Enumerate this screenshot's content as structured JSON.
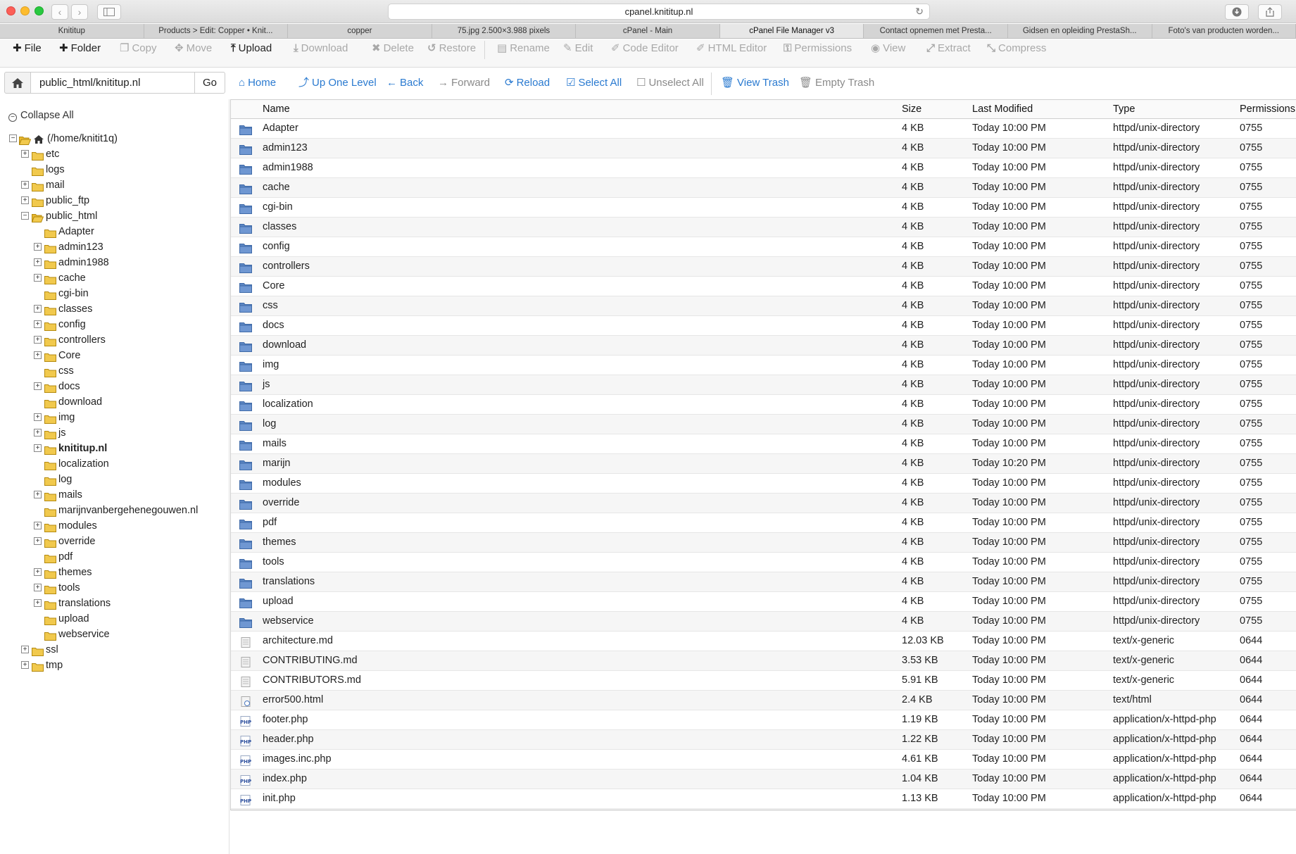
{
  "browser": {
    "url": "cpanel.knititup.nl",
    "tabs": [
      {
        "label": "Knititup",
        "active": false
      },
      {
        "label": "Products > Edit: Copper • Knit...",
        "active": false
      },
      {
        "label": "copper",
        "active": false
      },
      {
        "label": "75.jpg 2.500×3.988 pixels",
        "active": false
      },
      {
        "label": "cPanel - Main",
        "active": false
      },
      {
        "label": "cPanel File Manager v3",
        "active": true
      },
      {
        "label": "Contact opnemen met Presta...",
        "active": false
      },
      {
        "label": "Gidsen en opleiding PrestaSh...",
        "active": false
      },
      {
        "label": "Foto's van producten worden...",
        "active": false
      }
    ]
  },
  "toolbar": {
    "buttons": [
      {
        "label": "File",
        "icon": "plus-icon",
        "enabled": true
      },
      {
        "label": "Folder",
        "icon": "plus-icon",
        "enabled": true
      },
      {
        "label": "Copy",
        "icon": "copy-icon",
        "enabled": false
      },
      {
        "label": "Move",
        "icon": "move-icon",
        "enabled": false
      },
      {
        "label": "Upload",
        "icon": "upload-icon",
        "enabled": true
      },
      {
        "label": "Download",
        "icon": "download-icon",
        "enabled": false
      },
      {
        "label": "Delete",
        "icon": "delete-icon",
        "enabled": false
      },
      {
        "label": "Restore",
        "icon": "restore-icon",
        "enabled": false
      },
      {
        "label": "Rename",
        "icon": "rename-icon",
        "enabled": false
      },
      {
        "label": "Edit",
        "icon": "pencil-icon",
        "enabled": false
      },
      {
        "label": "Code Editor",
        "icon": "code-editor-icon",
        "enabled": false
      },
      {
        "label": "HTML Editor",
        "icon": "html-editor-icon",
        "enabled": false
      },
      {
        "label": "Permissions",
        "icon": "key-icon",
        "enabled": false
      },
      {
        "label": "View",
        "icon": "eye-icon",
        "enabled": false
      },
      {
        "label": "Extract",
        "icon": "extract-icon",
        "enabled": false
      },
      {
        "label": "Compress",
        "icon": "compress-icon",
        "enabled": false
      }
    ]
  },
  "pathbar": {
    "path": "public_html/knititup.nl",
    "go_label": "Go",
    "links": [
      {
        "label": "Home",
        "icon": "home-icon",
        "enabled": true
      },
      {
        "label": "Up One Level",
        "icon": "level-up-icon",
        "enabled": true
      },
      {
        "label": "Back",
        "icon": "arrow-left-icon",
        "enabled": true
      },
      {
        "label": "Forward",
        "icon": "arrow-right-icon",
        "enabled": false
      },
      {
        "label": "Reload",
        "icon": "reload-icon",
        "enabled": true
      },
      {
        "label": "Select All",
        "icon": "check-square-icon",
        "enabled": true
      },
      {
        "label": "Unselect All",
        "icon": "square-icon",
        "enabled": false
      },
      {
        "label": "View Trash",
        "icon": "trash-icon",
        "enabled": true
      },
      {
        "label": "Empty Trash",
        "icon": "trash-icon",
        "enabled": false
      }
    ]
  },
  "tree": {
    "collapse_label": "Collapse All",
    "root_label": "(/home/knitit1q)",
    "nodes": [
      {
        "label": "etc",
        "level": 1,
        "toggle": "plus"
      },
      {
        "label": "logs",
        "level": 1,
        "toggle": ""
      },
      {
        "label": "mail",
        "level": 1,
        "toggle": "plus"
      },
      {
        "label": "public_ftp",
        "level": 1,
        "toggle": "plus"
      },
      {
        "label": "public_html",
        "level": 1,
        "toggle": "minus",
        "open": true
      },
      {
        "label": "Adapter",
        "level": 2,
        "toggle": ""
      },
      {
        "label": "admin123",
        "level": 2,
        "toggle": "plus"
      },
      {
        "label": "admin1988",
        "level": 2,
        "toggle": "plus"
      },
      {
        "label": "cache",
        "level": 2,
        "toggle": "plus"
      },
      {
        "label": "cgi-bin",
        "level": 2,
        "toggle": ""
      },
      {
        "label": "classes",
        "level": 2,
        "toggle": "plus"
      },
      {
        "label": "config",
        "level": 2,
        "toggle": "plus"
      },
      {
        "label": "controllers",
        "level": 2,
        "toggle": "plus"
      },
      {
        "label": "Core",
        "level": 2,
        "toggle": "plus"
      },
      {
        "label": "css",
        "level": 2,
        "toggle": ""
      },
      {
        "label": "docs",
        "level": 2,
        "toggle": "plus"
      },
      {
        "label": "download",
        "level": 2,
        "toggle": ""
      },
      {
        "label": "img",
        "level": 2,
        "toggle": "plus"
      },
      {
        "label": "js",
        "level": 2,
        "toggle": "plus"
      },
      {
        "label": "knititup.nl",
        "level": 2,
        "toggle": "plus",
        "bold": true
      },
      {
        "label": "localization",
        "level": 2,
        "toggle": ""
      },
      {
        "label": "log",
        "level": 2,
        "toggle": ""
      },
      {
        "label": "mails",
        "level": 2,
        "toggle": "plus"
      },
      {
        "label": "marijnvanbergehenegouwen.nl",
        "level": 2,
        "toggle": ""
      },
      {
        "label": "modules",
        "level": 2,
        "toggle": "plus"
      },
      {
        "label": "override",
        "level": 2,
        "toggle": "plus"
      },
      {
        "label": "pdf",
        "level": 2,
        "toggle": ""
      },
      {
        "label": "themes",
        "level": 2,
        "toggle": "plus"
      },
      {
        "label": "tools",
        "level": 2,
        "toggle": "plus"
      },
      {
        "label": "translations",
        "level": 2,
        "toggle": "plus"
      },
      {
        "label": "upload",
        "level": 2,
        "toggle": ""
      },
      {
        "label": "webservice",
        "level": 2,
        "toggle": ""
      },
      {
        "label": "ssl",
        "level": 1,
        "toggle": "plus"
      },
      {
        "label": "tmp",
        "level": 1,
        "toggle": "plus"
      }
    ]
  },
  "table": {
    "columns": [
      "Name",
      "Size",
      "Last Modified",
      "Type",
      "Permissions"
    ],
    "rows": [
      {
        "name": "Adapter",
        "size": "4 KB",
        "modified": "Today 10:00 PM",
        "type": "httpd/unix-directory",
        "perms": "0755",
        "icon": "folder-icon"
      },
      {
        "name": "admin123",
        "size": "4 KB",
        "modified": "Today 10:00 PM",
        "type": "httpd/unix-directory",
        "perms": "0755",
        "icon": "folder-icon"
      },
      {
        "name": "admin1988",
        "size": "4 KB",
        "modified": "Today 10:00 PM",
        "type": "httpd/unix-directory",
        "perms": "0755",
        "icon": "folder-icon"
      },
      {
        "name": "cache",
        "size": "4 KB",
        "modified": "Today 10:00 PM",
        "type": "httpd/unix-directory",
        "perms": "0755",
        "icon": "folder-icon"
      },
      {
        "name": "cgi-bin",
        "size": "4 KB",
        "modified": "Today 10:00 PM",
        "type": "httpd/unix-directory",
        "perms": "0755",
        "icon": "folder-icon"
      },
      {
        "name": "classes",
        "size": "4 KB",
        "modified": "Today 10:00 PM",
        "type": "httpd/unix-directory",
        "perms": "0755",
        "icon": "folder-icon"
      },
      {
        "name": "config",
        "size": "4 KB",
        "modified": "Today 10:00 PM",
        "type": "httpd/unix-directory",
        "perms": "0755",
        "icon": "folder-icon"
      },
      {
        "name": "controllers",
        "size": "4 KB",
        "modified": "Today 10:00 PM",
        "type": "httpd/unix-directory",
        "perms": "0755",
        "icon": "folder-icon"
      },
      {
        "name": "Core",
        "size": "4 KB",
        "modified": "Today 10:00 PM",
        "type": "httpd/unix-directory",
        "perms": "0755",
        "icon": "folder-icon"
      },
      {
        "name": "css",
        "size": "4 KB",
        "modified": "Today 10:00 PM",
        "type": "httpd/unix-directory",
        "perms": "0755",
        "icon": "folder-icon"
      },
      {
        "name": "docs",
        "size": "4 KB",
        "modified": "Today 10:00 PM",
        "type": "httpd/unix-directory",
        "perms": "0755",
        "icon": "folder-icon"
      },
      {
        "name": "download",
        "size": "4 KB",
        "modified": "Today 10:00 PM",
        "type": "httpd/unix-directory",
        "perms": "0755",
        "icon": "folder-icon"
      },
      {
        "name": "img",
        "size": "4 KB",
        "modified": "Today 10:00 PM",
        "type": "httpd/unix-directory",
        "perms": "0755",
        "icon": "folder-icon"
      },
      {
        "name": "js",
        "size": "4 KB",
        "modified": "Today 10:00 PM",
        "type": "httpd/unix-directory",
        "perms": "0755",
        "icon": "folder-icon"
      },
      {
        "name": "localization",
        "size": "4 KB",
        "modified": "Today 10:00 PM",
        "type": "httpd/unix-directory",
        "perms": "0755",
        "icon": "folder-icon"
      },
      {
        "name": "log",
        "size": "4 KB",
        "modified": "Today 10:00 PM",
        "type": "httpd/unix-directory",
        "perms": "0755",
        "icon": "folder-icon"
      },
      {
        "name": "mails",
        "size": "4 KB",
        "modified": "Today 10:00 PM",
        "type": "httpd/unix-directory",
        "perms": "0755",
        "icon": "folder-icon"
      },
      {
        "name": "marijn",
        "size": "4 KB",
        "modified": "Today 10:20 PM",
        "type": "httpd/unix-directory",
        "perms": "0755",
        "icon": "folder-icon"
      },
      {
        "name": "modules",
        "size": "4 KB",
        "modified": "Today 10:00 PM",
        "type": "httpd/unix-directory",
        "perms": "0755",
        "icon": "folder-icon"
      },
      {
        "name": "override",
        "size": "4 KB",
        "modified": "Today 10:00 PM",
        "type": "httpd/unix-directory",
        "perms": "0755",
        "icon": "folder-icon"
      },
      {
        "name": "pdf",
        "size": "4 KB",
        "modified": "Today 10:00 PM",
        "type": "httpd/unix-directory",
        "perms": "0755",
        "icon": "folder-icon"
      },
      {
        "name": "themes",
        "size": "4 KB",
        "modified": "Today 10:00 PM",
        "type": "httpd/unix-directory",
        "perms": "0755",
        "icon": "folder-icon"
      },
      {
        "name": "tools",
        "size": "4 KB",
        "modified": "Today 10:00 PM",
        "type": "httpd/unix-directory",
        "perms": "0755",
        "icon": "folder-icon"
      },
      {
        "name": "translations",
        "size": "4 KB",
        "modified": "Today 10:00 PM",
        "type": "httpd/unix-directory",
        "perms": "0755",
        "icon": "folder-icon"
      },
      {
        "name": "upload",
        "size": "4 KB",
        "modified": "Today 10:00 PM",
        "type": "httpd/unix-directory",
        "perms": "0755",
        "icon": "folder-icon"
      },
      {
        "name": "webservice",
        "size": "4 KB",
        "modified": "Today 10:00 PM",
        "type": "httpd/unix-directory",
        "perms": "0755",
        "icon": "folder-icon"
      },
      {
        "name": "architecture.md",
        "size": "12.03 KB",
        "modified": "Today 10:00 PM",
        "type": "text/x-generic",
        "perms": "0644",
        "icon": "text-file-icon"
      },
      {
        "name": "CONTRIBUTING.md",
        "size": "3.53 KB",
        "modified": "Today 10:00 PM",
        "type": "text/x-generic",
        "perms": "0644",
        "icon": "text-file-icon"
      },
      {
        "name": "CONTRIBUTORS.md",
        "size": "5.91 KB",
        "modified": "Today 10:00 PM",
        "type": "text/x-generic",
        "perms": "0644",
        "icon": "text-file-icon"
      },
      {
        "name": "error500.html",
        "size": "2.4 KB",
        "modified": "Today 10:00 PM",
        "type": "text/html",
        "perms": "0644",
        "icon": "html-file-icon"
      },
      {
        "name": "footer.php",
        "size": "1.19 KB",
        "modified": "Today 10:00 PM",
        "type": "application/x-httpd-php",
        "perms": "0644",
        "icon": "php-file-icon"
      },
      {
        "name": "header.php",
        "size": "1.22 KB",
        "modified": "Today 10:00 PM",
        "type": "application/x-httpd-php",
        "perms": "0644",
        "icon": "php-file-icon"
      },
      {
        "name": "images.inc.php",
        "size": "4.61 KB",
        "modified": "Today 10:00 PM",
        "type": "application/x-httpd-php",
        "perms": "0644",
        "icon": "php-file-icon"
      },
      {
        "name": "index.php",
        "size": "1.04 KB",
        "modified": "Today 10:00 PM",
        "type": "application/x-httpd-php",
        "perms": "0644",
        "icon": "php-file-icon"
      },
      {
        "name": "init.php",
        "size": "1.13 KB",
        "modified": "Today 10:00 PM",
        "type": "application/x-httpd-php",
        "perms": "0644",
        "icon": "php-file-icon"
      }
    ]
  },
  "colors": {
    "link_blue": "#2a7ad0",
    "folder_blue": "#5b85c2",
    "tree_folder_yellow": "#f1c94d",
    "disabled_gray": "#a8a8a8"
  }
}
